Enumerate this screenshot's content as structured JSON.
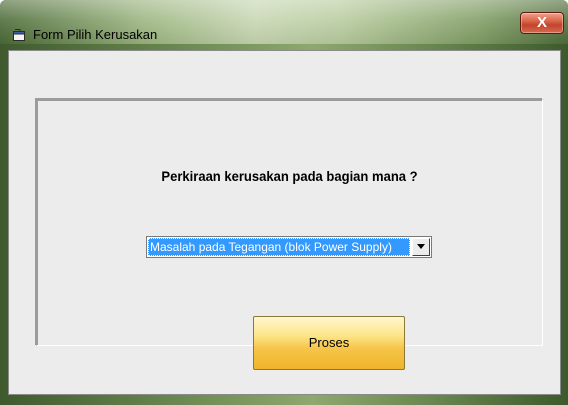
{
  "window": {
    "title": "Form Pilih Kerusakan",
    "close_label": "X"
  },
  "form": {
    "question": "Perkiraan kerusakan pada bagian mana ?",
    "combo_value": "Masalah pada Tegangan (blok Power Supply)",
    "submit_label": "Proses"
  },
  "colors": {
    "selection": "#3399ff",
    "button": "#f6c54a",
    "close": "#c1452b"
  }
}
